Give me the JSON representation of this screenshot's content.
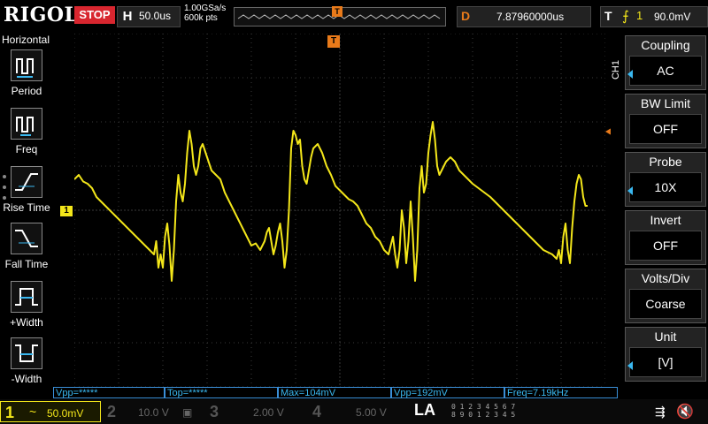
{
  "topbar": {
    "brand": "RIGOL",
    "run_status": "STOP",
    "horizontal_label": "H",
    "timebase": "50.0us",
    "sample_rate": "1.00GSa/s",
    "memory_depth": "600k pts",
    "trigger_marker": "T",
    "delay_label": "D",
    "delay_value": "7.87960000us",
    "trigger_label": "T",
    "trigger_edge_icon": "rising-edge-icon",
    "trigger_source": "1",
    "trigger_level": "90.0mV"
  },
  "left_menu": {
    "title": "Horizontal",
    "items": [
      {
        "label": "Period",
        "icon": "period-icon"
      },
      {
        "label": "Freq",
        "icon": "freq-icon"
      },
      {
        "label": "Rise Time",
        "icon": "rise-time-icon"
      },
      {
        "label": "Fall Time",
        "icon": "fall-time-icon"
      },
      {
        "label": "+Width",
        "icon": "positive-width-icon"
      },
      {
        "label": "-Width",
        "icon": "negative-width-icon"
      }
    ]
  },
  "right_menu": {
    "channel_tab": "CH1",
    "buttons": [
      {
        "title": "Coupling",
        "value": "AC"
      },
      {
        "title": "BW Limit",
        "value": "OFF"
      },
      {
        "title": "Probe",
        "value": "10X"
      },
      {
        "title": "Invert",
        "value": "OFF"
      },
      {
        "title": "Volts/Div",
        "value": "Coarse"
      },
      {
        "title": "Unit",
        "value": "[V]"
      }
    ]
  },
  "markers": {
    "ch1_ground": "1",
    "trigger_pos": "T"
  },
  "measurements": [
    {
      "text": "Vpp=*****"
    },
    {
      "text": "Top=*****"
    },
    {
      "text": "Max=104mV"
    },
    {
      "text": "Vpp=192mV"
    },
    {
      "text": "Freq=7.19kHz"
    }
  ],
  "bottombar": {
    "ch1": {
      "num": "1",
      "coupling": "~",
      "scale": "50.0mV"
    },
    "ch2": {
      "num": "2",
      "scale": "10.0 V"
    },
    "ch3": {
      "num": "3",
      "scale": "2.00 V"
    },
    "ch4": {
      "num": "4",
      "scale": "5.00 V"
    },
    "la_label": "LA",
    "la_row1": "0 1 2 3 4 5 6 7",
    "la_row2": "8 9 0 1 2 3 4 5"
  },
  "colors": {
    "ch1": "#f3e61a",
    "ch2": "#20c4e8",
    "ch3": "#d040c0",
    "ch4": "#2060d8",
    "trigger": "#e87a1a",
    "stop": "#d8262f",
    "grid": "#3a3a3a"
  },
  "waveform": {
    "description_channel": "CH1",
    "h_divisions": 12,
    "v_divisions": 8,
    "samples_div": [
      [
        0,
        0.7
      ],
      [
        0.1,
        0.8
      ],
      [
        0.2,
        0.65
      ],
      [
        0.3,
        0.6
      ],
      [
        0.4,
        0.5
      ],
      [
        0.5,
        0.3
      ],
      [
        0.7,
        0.1
      ],
      [
        0.9,
        -0.1
      ],
      [
        1.1,
        -0.3
      ],
      [
        1.3,
        -0.5
      ],
      [
        1.5,
        -0.7
      ],
      [
        1.7,
        -0.9
      ],
      [
        1.8,
        -1.0
      ],
      [
        1.85,
        -0.7
      ],
      [
        1.9,
        -1.3
      ],
      [
        1.95,
        -1.0
      ],
      [
        2.0,
        -1.3
      ],
      [
        2.05,
        -0.6
      ],
      [
        2.1,
        -0.3
      ],
      [
        2.15,
        -0.8
      ],
      [
        2.2,
        -1.6
      ],
      [
        2.25,
        -0.9
      ],
      [
        2.3,
        0.2
      ],
      [
        2.35,
        0.8
      ],
      [
        2.4,
        0.4
      ],
      [
        2.45,
        0.2
      ],
      [
        2.5,
        0.6
      ],
      [
        2.55,
        1.3
      ],
      [
        2.6,
        1.8
      ],
      [
        2.65,
        1.5
      ],
      [
        2.7,
        1.0
      ],
      [
        2.75,
        0.8
      ],
      [
        2.8,
        1.0
      ],
      [
        2.85,
        1.4
      ],
      [
        2.9,
        1.5
      ],
      [
        3.0,
        1.2
      ],
      [
        3.1,
        0.9
      ],
      [
        3.2,
        0.8
      ],
      [
        3.3,
        0.7
      ],
      [
        3.4,
        0.4
      ],
      [
        3.5,
        0.2
      ],
      [
        3.6,
        0.0
      ],
      [
        3.7,
        -0.2
      ],
      [
        3.8,
        -0.4
      ],
      [
        3.9,
        -0.6
      ],
      [
        4.0,
        -0.8
      ],
      [
        4.1,
        -0.75
      ],
      [
        4.2,
        -0.9
      ],
      [
        4.3,
        -0.7
      ],
      [
        4.35,
        -0.5
      ],
      [
        4.4,
        -0.4
      ],
      [
        4.45,
        -0.7
      ],
      [
        4.5,
        -1.0
      ],
      [
        4.55,
        -0.8
      ],
      [
        4.6,
        -0.5
      ],
      [
        4.65,
        -0.3
      ],
      [
        4.7,
        -0.7
      ],
      [
        4.75,
        -1.3
      ],
      [
        4.8,
        -0.9
      ],
      [
        4.85,
        0.0
      ],
      [
        4.9,
        1.4
      ],
      [
        4.95,
        1.8
      ],
      [
        5.0,
        1.7
      ],
      [
        5.05,
        1.5
      ],
      [
        5.1,
        1.6
      ],
      [
        5.15,
        1.0
      ],
      [
        5.2,
        0.7
      ],
      [
        5.25,
        0.6
      ],
      [
        5.3,
        0.9
      ],
      [
        5.35,
        1.2
      ],
      [
        5.4,
        1.4
      ],
      [
        5.5,
        1.5
      ],
      [
        5.6,
        1.3
      ],
      [
        5.7,
        1.0
      ],
      [
        5.8,
        0.8
      ],
      [
        5.9,
        0.55
      ],
      [
        6.0,
        0.45
      ],
      [
        6.1,
        0.35
      ],
      [
        6.2,
        0.25
      ],
      [
        6.3,
        0.2
      ],
      [
        6.4,
        0.1
      ],
      [
        6.5,
        -0.1
      ],
      [
        6.6,
        -0.3
      ],
      [
        6.7,
        -0.4
      ],
      [
        6.8,
        -0.6
      ],
      [
        6.9,
        -0.7
      ],
      [
        7.0,
        -0.9
      ],
      [
        7.1,
        -1.0
      ],
      [
        7.15,
        -0.8
      ],
      [
        7.2,
        -0.6
      ],
      [
        7.25,
        -1.0
      ],
      [
        7.3,
        -1.3
      ],
      [
        7.35,
        -0.9
      ],
      [
        7.4,
        0.0
      ],
      [
        7.45,
        -0.4
      ],
      [
        7.5,
        -1.2
      ],
      [
        7.55,
        -0.7
      ],
      [
        7.6,
        0.2
      ],
      [
        7.65,
        -0.6
      ],
      [
        7.7,
        -1.6
      ],
      [
        7.75,
        -0.9
      ],
      [
        7.8,
        0.5
      ],
      [
        7.85,
        1.0
      ],
      [
        7.9,
        0.4
      ],
      [
        7.95,
        0.6
      ],
      [
        8.0,
        1.3
      ],
      [
        8.05,
        1.7
      ],
      [
        8.1,
        2.0
      ],
      [
        8.15,
        1.6
      ],
      [
        8.2,
        1.0
      ],
      [
        8.25,
        0.8
      ],
      [
        8.3,
        0.9
      ],
      [
        8.4,
        1.1
      ],
      [
        8.5,
        1.2
      ],
      [
        8.6,
        1.1
      ],
      [
        8.7,
        0.9
      ],
      [
        8.8,
        0.8
      ],
      [
        8.9,
        0.7
      ],
      [
        9.0,
        0.6
      ],
      [
        9.2,
        0.45
      ],
      [
        9.4,
        0.3
      ],
      [
        9.6,
        0.1
      ],
      [
        9.8,
        -0.1
      ],
      [
        10.0,
        -0.3
      ],
      [
        10.2,
        -0.5
      ],
      [
        10.4,
        -0.7
      ],
      [
        10.6,
        -0.9
      ],
      [
        10.8,
        -1.0
      ],
      [
        10.9,
        -1.1
      ],
      [
        10.95,
        -0.9
      ],
      [
        11.0,
        -1.2
      ],
      [
        11.05,
        -0.6
      ],
      [
        11.1,
        -0.3
      ],
      [
        11.15,
        -0.9
      ],
      [
        11.2,
        -1.2
      ],
      [
        11.25,
        -0.4
      ],
      [
        11.3,
        0.2
      ],
      [
        11.35,
        0.6
      ],
      [
        11.4,
        0.8
      ],
      [
        11.45,
        0.7
      ],
      [
        11.5,
        0.3
      ],
      [
        11.55,
        0.1
      ],
      [
        11.6,
        0.1
      ]
    ]
  }
}
